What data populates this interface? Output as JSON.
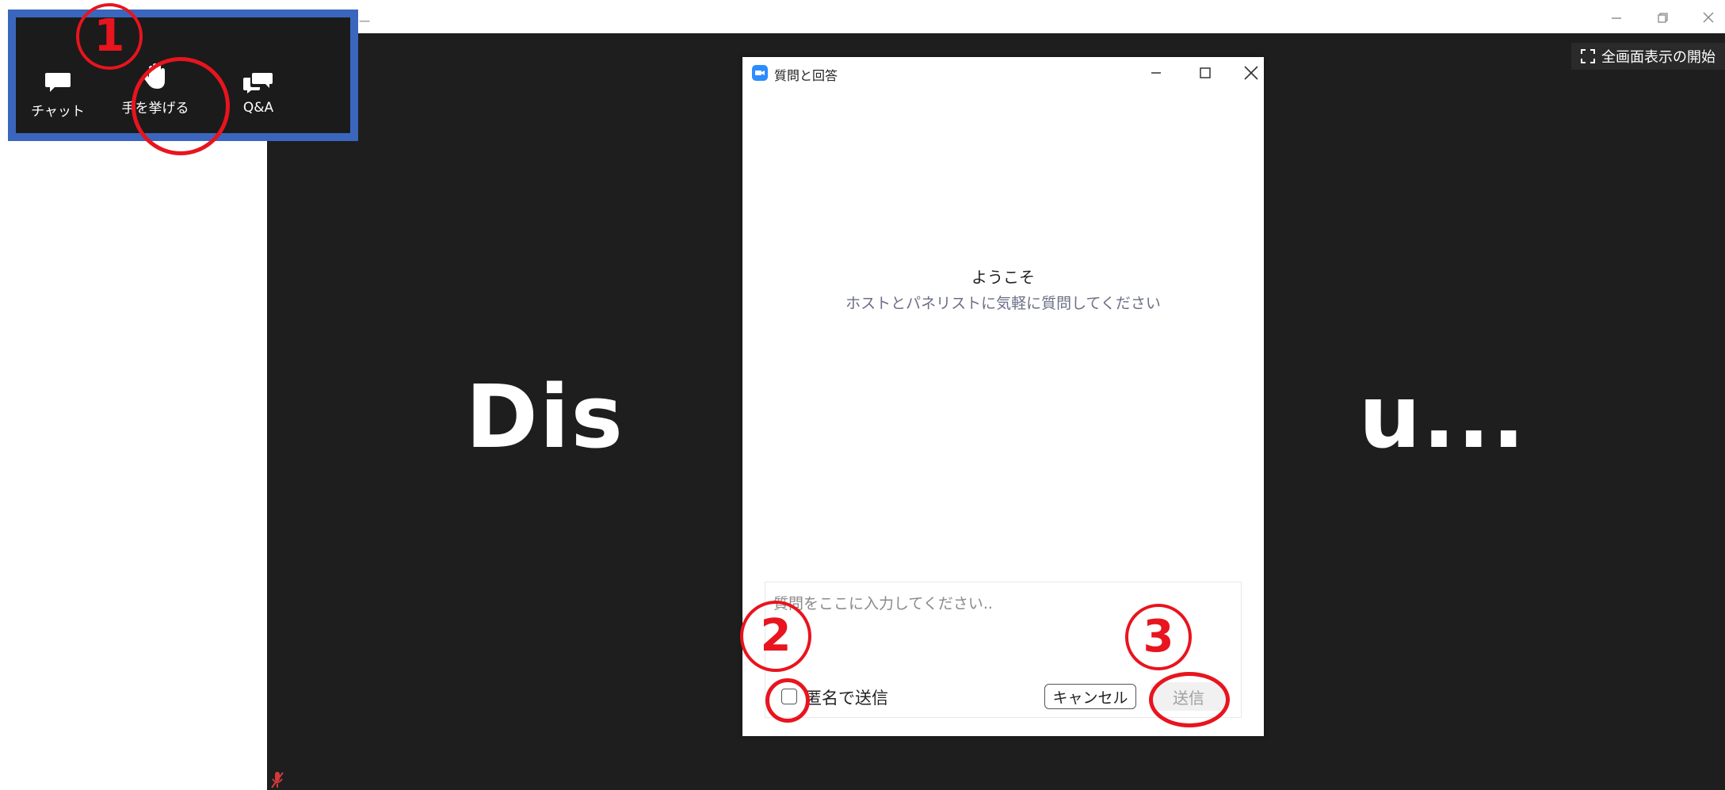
{
  "window": {
    "title_fragment": "ー",
    "controls": [
      "minimize-icon",
      "restore-icon",
      "close-icon"
    ]
  },
  "stage": {
    "shared_screen_text": "Dis                       u...",
    "fullscreen_label": "全画面表示の開始"
  },
  "toolbar": {
    "items": [
      {
        "label": "チャット",
        "icon": "chat-bubble-icon"
      },
      {
        "label": "手を挙げる",
        "icon": "raise-hand-icon"
      },
      {
        "label": "Q&A",
        "icon": "qa-bubbles-icon"
      }
    ]
  },
  "dialog": {
    "title": "質問と回答",
    "welcome": "ようこそ",
    "welcome_sub": "ホストとパネリストに気軽に質問してください",
    "input_placeholder": "質問をここに入力してください..",
    "anonymous_label": "匿名で送信",
    "anonymous_checked": false,
    "cancel_label": "キャンセル",
    "send_label": "送信"
  },
  "annotations": {
    "step1": "1",
    "step2": "2",
    "step3": "3",
    "color": "#e8141e",
    "frame_color": "#3a67bd"
  }
}
